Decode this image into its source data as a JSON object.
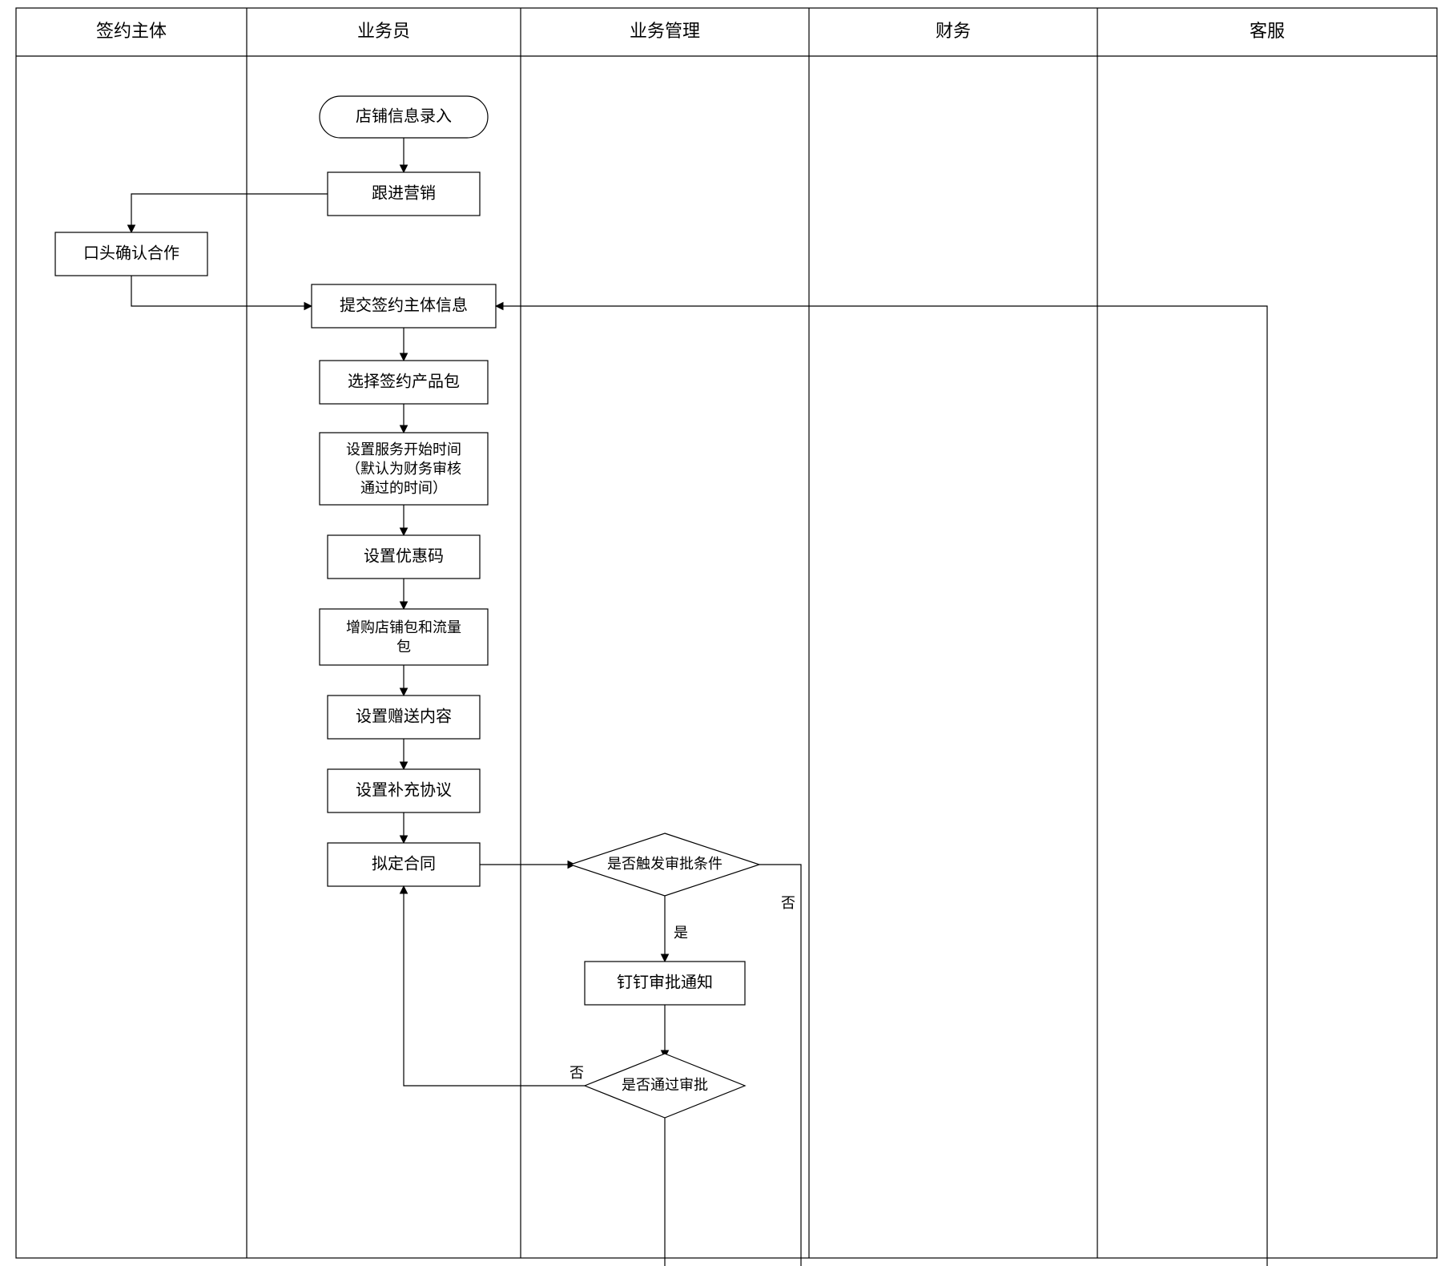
{
  "lanes": {
    "l1": "签约主体",
    "l2": "业务员",
    "l3": "业务管理",
    "l4": "财务",
    "l5": "客服"
  },
  "nodes": {
    "start": "店铺信息录入",
    "follow": "跟进营销",
    "verbal": "口头确认合作",
    "submit": "提交签约主体信息",
    "choosePkg": "选择签约产品包",
    "setTime_l1": "设置服务开始时间",
    "setTime_l2": "（默认为财务审核",
    "setTime_l3": "通过的时间）",
    "coupon": "设置优惠码",
    "addon_l1": "增购店铺包和流量",
    "addon_l2": "包",
    "gift": "设置赠送内容",
    "supp": "设置补充协议",
    "draft": "拟定合同",
    "trigger": "是否触发审批条件",
    "ding": "钉钉审批通知",
    "pass": "是否通过审批"
  },
  "labels": {
    "yes": "是",
    "no": "否"
  }
}
